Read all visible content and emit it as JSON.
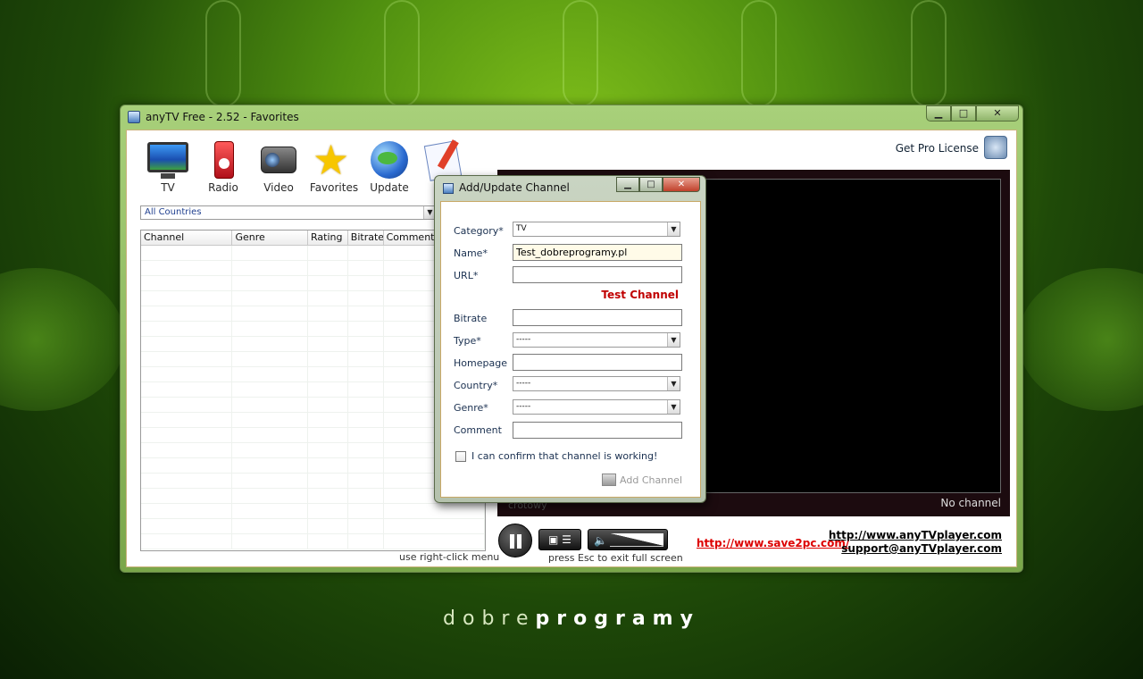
{
  "window": {
    "title": "anyTV Free - 2.52 - Favorites",
    "minimize": "▁",
    "maximize": "□",
    "close": "✕"
  },
  "toolbar": {
    "items": [
      {
        "label": "TV",
        "icon": "tv-icon"
      },
      {
        "label": "Radio",
        "icon": "radio-icon"
      },
      {
        "label": "Video",
        "icon": "video-camera-icon"
      },
      {
        "label": "Favorites",
        "icon": "star-icon"
      },
      {
        "label": "Update",
        "icon": "globe-icon"
      },
      {
        "label": "",
        "icon": "edit-icon"
      }
    ]
  },
  "get_pro": {
    "label": "Get Pro License"
  },
  "country_filter": {
    "value": "All Countries"
  },
  "table": {
    "columns": [
      "Channel",
      "Genre",
      "Rating",
      "Bitrate",
      "Comments"
    ]
  },
  "hints": {
    "context_menu": "use right-click menu",
    "esc": "press Esc to exit full screen"
  },
  "player": {
    "status": "No channel",
    "caption": "crotowy"
  },
  "links": {
    "save2pc": "http://www.save2pc.com/",
    "site": "http://www.anyTVplayer.com",
    "support": "support@anyTVplayer.com"
  },
  "dialog": {
    "title": "Add/Update Channel",
    "fields": {
      "category": {
        "label": "Category*",
        "value": "TV"
      },
      "name": {
        "label": "Name*",
        "value": "Test_dobreprogramy.pl"
      },
      "url": {
        "label": "URL*",
        "value": ""
      },
      "bitrate": {
        "label": "Bitrate",
        "value": ""
      },
      "type": {
        "label": "Type*",
        "value": "-----"
      },
      "homepage": {
        "label": "Homepage",
        "value": ""
      },
      "country": {
        "label": "Country*",
        "value": "-----"
      },
      "genre": {
        "label": "Genre*",
        "value": "-----"
      },
      "comment": {
        "label": "Comment",
        "value": ""
      }
    },
    "test_channel": "Test Channel",
    "confirm": "I can confirm that channel is working!",
    "add_button": "Add Channel"
  },
  "footer": {
    "logo_left": "dobre",
    "logo_right": "programy"
  }
}
